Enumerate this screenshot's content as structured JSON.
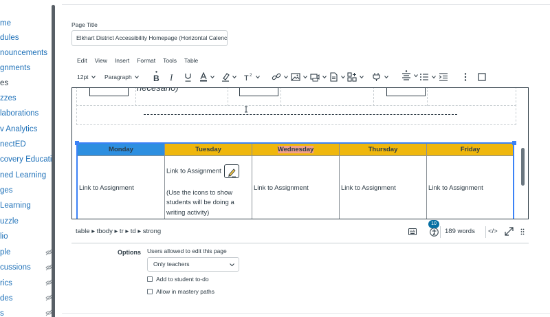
{
  "nav": {
    "items": [
      {
        "label": "me",
        "hidden": false
      },
      {
        "label": "dules",
        "hidden": false
      },
      {
        "label": "nouncements",
        "hidden": false
      },
      {
        "label": "gnments",
        "hidden": false
      },
      {
        "label": "es",
        "hidden": false,
        "active": true
      },
      {
        "label": "zzes",
        "hidden": false
      },
      {
        "label": "laborations",
        "hidden": false
      },
      {
        "label": "v Analytics",
        "hidden": false
      },
      {
        "label": "nectED",
        "hidden": false
      },
      {
        "label": "covery Education",
        "hidden": false
      },
      {
        "label": "ned Learning",
        "hidden": false
      },
      {
        "label": "ges",
        "hidden": false
      },
      {
        "label": "Learning",
        "hidden": false
      },
      {
        "label": "uzzle",
        "hidden": false
      },
      {
        "label": "lio",
        "hidden": false
      },
      {
        "label": "ple",
        "hidden": true
      },
      {
        "label": "cussions",
        "hidden": true
      },
      {
        "label": "rics",
        "hidden": true
      },
      {
        "label": "des",
        "hidden": true
      },
      {
        "label": "s",
        "hidden": true
      }
    ]
  },
  "title_field": {
    "label": "Page Title",
    "value": "Elkhart District Accessibility Homepage (Horizontal Calenc"
  },
  "menubar": [
    "Edit",
    "View",
    "Insert",
    "Format",
    "Tools",
    "Table"
  ],
  "toolbar": {
    "font_size": "12pt",
    "block_format": "Paragraph"
  },
  "editor": {
    "partial_text": "necesario)",
    "week_table": {
      "headers": [
        {
          "label": "Monday",
          "color": "#2d8fe0"
        },
        {
          "label": "Tuesday",
          "color": "#efb70d"
        },
        {
          "label": "Wednesday",
          "color": "#efb70d"
        },
        {
          "label": "Thursday",
          "color": "#efb70d"
        },
        {
          "label": "Friday",
          "color": "#efb70d"
        }
      ],
      "cells": {
        "monday": "Link to Assignment",
        "tuesday_link": "Link to Assignment",
        "tuesday_note": "(Use the icons to show students will be doing a writing activity)",
        "wednesday": "Link to Assignment",
        "thursday": "Link to Assignment",
        "friday": "Link to Assignment"
      }
    }
  },
  "statusbar": {
    "path": "table ▸ tbody ▸ tr ▸ td ▸ strong",
    "a11y_count": "10",
    "word_count": "189 words",
    "code_view": "</>"
  },
  "options": {
    "label": "Options",
    "users_label": "Users allowed to edit this page",
    "users_value": "Only teachers",
    "todo_label": "Add to student to-do",
    "mastery_label": "Allow in mastery paths"
  },
  "colors": {
    "link": "#1d70b8",
    "monday_header": "#2d8fe0",
    "weekday_header": "#efb70d",
    "selection": "#3b82f6",
    "badge": "#0770a3"
  }
}
